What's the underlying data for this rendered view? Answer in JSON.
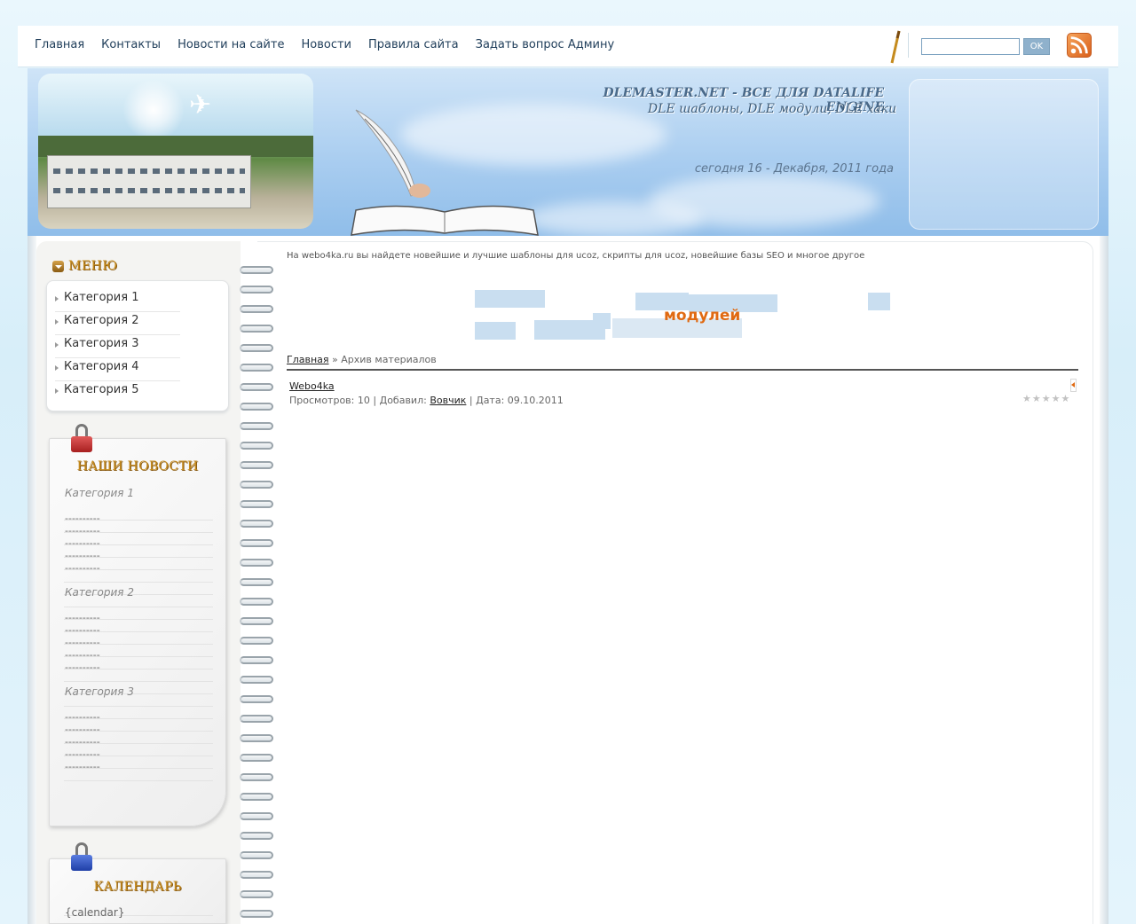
{
  "nav": {
    "items": [
      {
        "label": "Главная"
      },
      {
        "label": "Контакты"
      },
      {
        "label": "Новости на сайте"
      },
      {
        "label": "Новости"
      },
      {
        "label": "Правила сайта"
      },
      {
        "label": "Задать вопрос Админу"
      }
    ],
    "search_value": "",
    "ok_label": "OK"
  },
  "header": {
    "title": "DLEMASTER.NET - ВСЕ ДЛЯ DATALIFE ENGINE",
    "subtitle": "DLE шаблоны, DLE модули, DLE хаки",
    "date": "сегодня 16 - Декабря, 2011 года"
  },
  "sidebar": {
    "menu_title": "МЕНЮ",
    "menu_items": [
      {
        "label": "Категория 1"
      },
      {
        "label": "Категория 2"
      },
      {
        "label": "Категория 3"
      },
      {
        "label": "Категория 4"
      },
      {
        "label": "Категория 5"
      }
    ],
    "news_title": "НАШИ НОВОСТИ",
    "news_groups": [
      {
        "category": "Категория 1",
        "items": [
          "----------",
          "----------",
          "----------",
          "----------",
          "----------"
        ]
      },
      {
        "category": "Категория 2",
        "items": [
          "----------",
          "----------",
          "----------",
          "----------",
          "----------"
        ]
      },
      {
        "category": "Категория 3",
        "items": [
          "----------",
          "----------",
          "----------",
          "----------",
          "----------"
        ]
      }
    ],
    "calendar_title": "КАЛЕНДАРЬ",
    "calendar_placeholder": "{calendar}"
  },
  "content": {
    "intro": "На webo4ka.ru вы найдете новейшие и лучшие шаблоны для ucoz, скрипты для ucoz, новейшие базы SEO и многое другое",
    "banner_text": "модулей",
    "breadcrumb": {
      "home": "Главная",
      "separator": "»",
      "current": "Архив материалов"
    },
    "entry": {
      "title": "Webo4ka",
      "views_label": "Просмотров:",
      "views": "10",
      "added_label": "Добавил:",
      "author": "Вовчик",
      "date_label": "Дата:",
      "date": "09.10.2011",
      "rating": 0,
      "rating_max": 5
    }
  },
  "colors": {
    "accent_gold": "#c58b1e",
    "banner_orange": "#e06a12",
    "nav_text": "#213f5b"
  }
}
